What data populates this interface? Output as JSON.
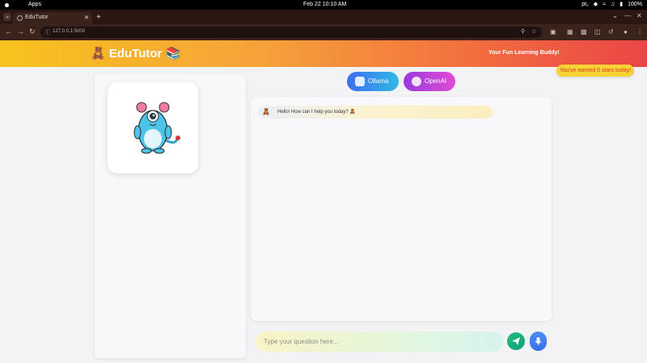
{
  "os": {
    "apps_label": "Apps",
    "clock": "Feb 22  10:10 AM",
    "keyboard": "pt₂",
    "battery": "100%"
  },
  "browser": {
    "tab_title": "EduTutor",
    "new_tab": "+",
    "url": "127.0.0.1:5000"
  },
  "header": {
    "brand": "🧸 EduTutor 📚",
    "tagline": "Your Fun Learning Buddy!"
  },
  "stars_badge": "You've earned 0 stars today!",
  "models": [
    {
      "label": "Ollama"
    },
    {
      "label": "OpenAI"
    }
  ],
  "chat": {
    "messages": [
      {
        "sender": "bot",
        "icon": "🧸",
        "text": "Hello! How can I help you today? 🧸"
      }
    ],
    "input_placeholder": "Type your question here...",
    "input_value": ""
  },
  "icons": {
    "send": "paper-plane-icon",
    "mic": "microphone-icon"
  },
  "colors": {
    "header_start": "#f7c21d",
    "header_end": "#ea4647",
    "ollama_start": "#3d6ef0",
    "openai_start": "#9a3be0",
    "send": "#1fbf7a",
    "mic": "#3a71ea",
    "stars_text": "#d93a2b"
  }
}
